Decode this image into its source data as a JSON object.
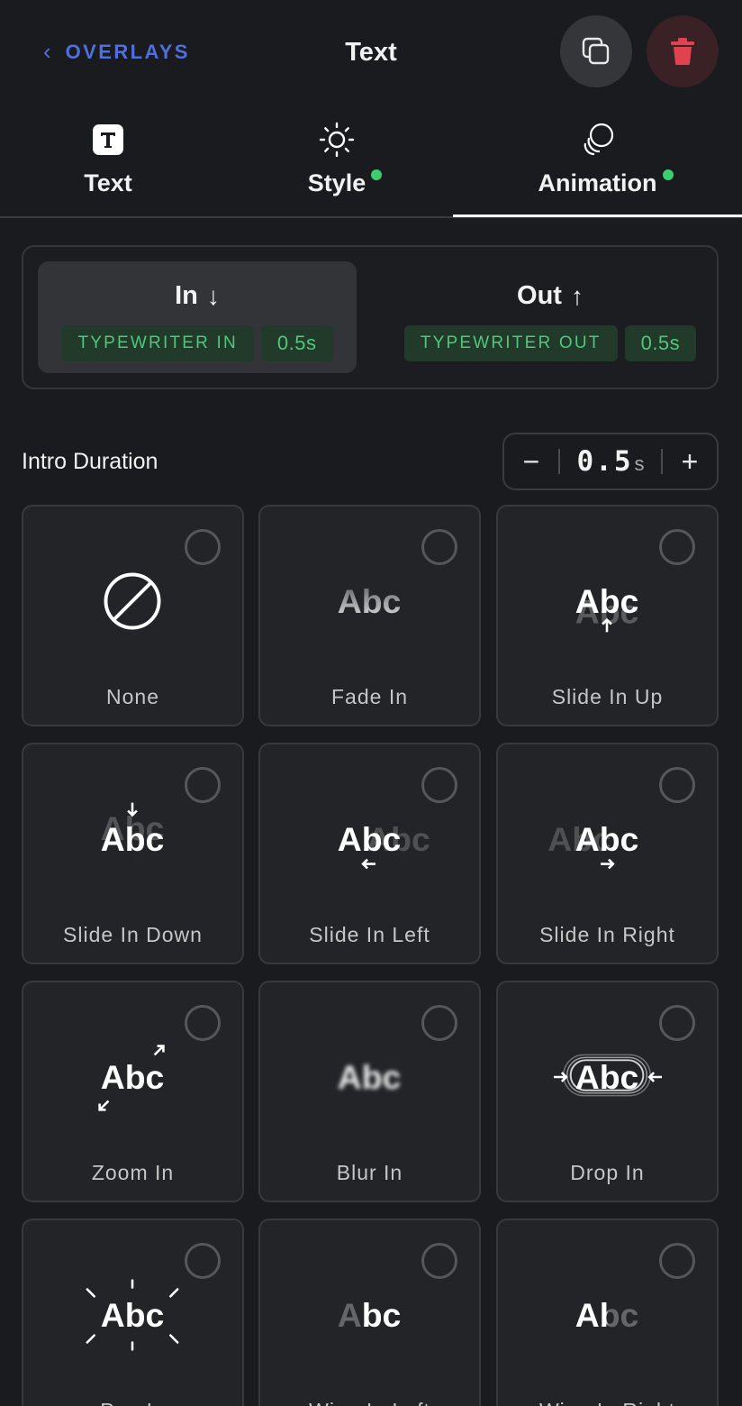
{
  "header": {
    "back_label": "OVERLAYS",
    "title": "Text"
  },
  "tabs": [
    {
      "label": "Text",
      "has_dot": false,
      "active": false
    },
    {
      "label": "Style",
      "has_dot": true,
      "active": false
    },
    {
      "label": "Animation",
      "has_dot": true,
      "active": true
    }
  ],
  "in_out": {
    "in": {
      "label": "In",
      "arrow": "↓",
      "effect": "TYPEWRITER IN",
      "duration": "0.5s",
      "selected": true
    },
    "out": {
      "label": "Out",
      "arrow": "↑",
      "effect": "TYPEWRITER OUT",
      "duration": "0.5s",
      "selected": false
    }
  },
  "intro_duration": {
    "label": "Intro Duration",
    "minus": "−",
    "value": "0.5",
    "unit": "s",
    "plus": "+"
  },
  "animations": [
    {
      "label": "None"
    },
    {
      "label": "Fade In"
    },
    {
      "label": "Slide In Up"
    },
    {
      "label": "Slide In Down"
    },
    {
      "label": "Slide In Left"
    },
    {
      "label": "Slide In Right"
    },
    {
      "label": "Zoom In"
    },
    {
      "label": "Blur In"
    },
    {
      "label": "Drop In"
    },
    {
      "label": "Pop In"
    },
    {
      "label": "Wipe In Left"
    },
    {
      "label": "Wipe In Right"
    }
  ],
  "demo_text": "Abc",
  "colors": {
    "accent_blue": "#4f6fdc",
    "green": "#4fc77c",
    "dot_green": "#3ccf6e",
    "delete_red": "#e0434f"
  }
}
